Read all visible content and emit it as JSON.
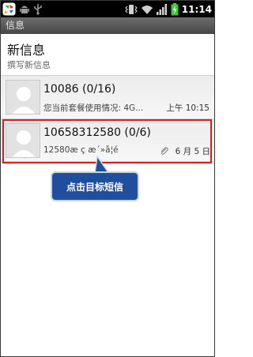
{
  "status_bar": {
    "time": "11:14",
    "icons": [
      "app-logo-icon",
      "android-icon",
      "usb-icon",
      "vibrate-icon",
      "wifi-icon",
      "signal-icon",
      "battery-icon"
    ]
  },
  "title_bar": {
    "title": "信息"
  },
  "compose": {
    "title": "新信息",
    "subtitle": "撰写新信息"
  },
  "threads": [
    {
      "name": "10086 (0/16)",
      "snippet": "您当前套餐使用情况: 4G...",
      "date": "上午 10:15"
    },
    {
      "name": "10658312580 (0/6)",
      "snippet": "12580æ ç æ´»å¦é ",
      "date": "6 月 5 日"
    }
  ],
  "callout": {
    "text": "点击目标短信"
  },
  "colors": {
    "highlight": "#d81e1e",
    "callout_bg": "#1f4e9c",
    "titlebar": "#555555"
  }
}
